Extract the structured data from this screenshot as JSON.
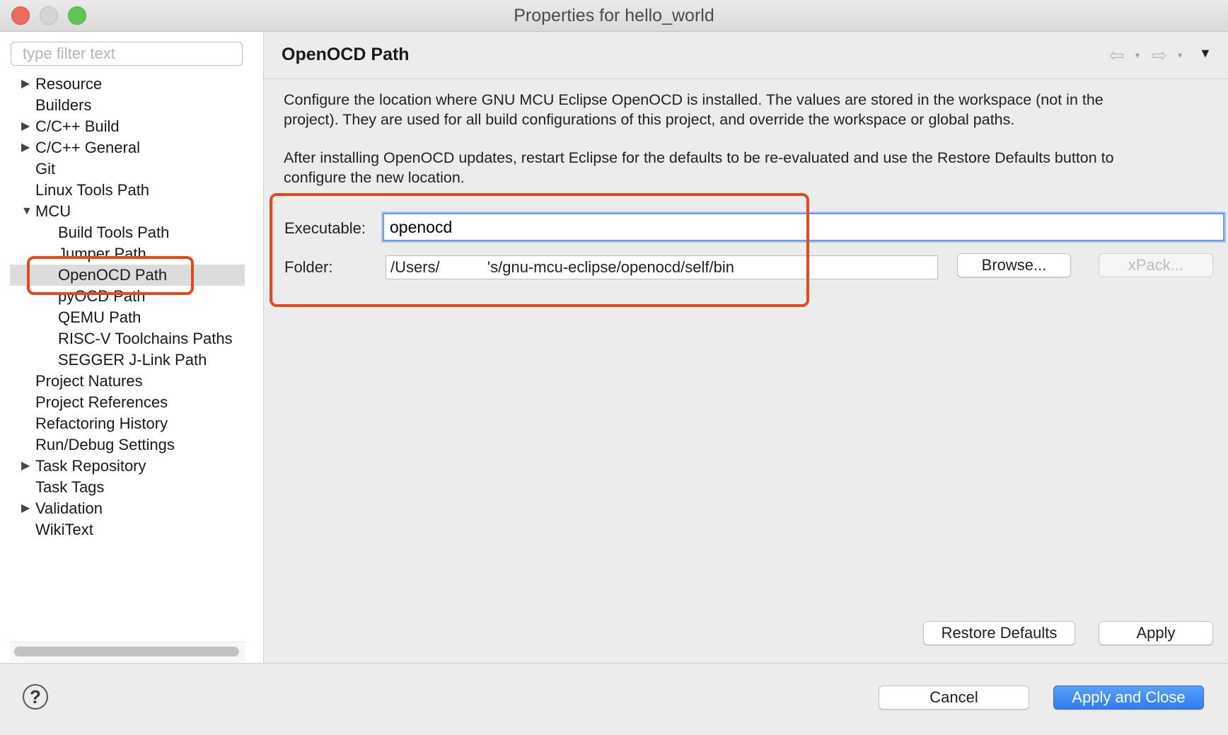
{
  "window": {
    "title": "Properties for hello_world"
  },
  "filter": {
    "placeholder": "type filter text",
    "value": ""
  },
  "tree": [
    {
      "label": "Resource",
      "expander": "▶"
    },
    {
      "label": "Builders",
      "expander": ""
    },
    {
      "label": "C/C++ Build",
      "expander": "▶"
    },
    {
      "label": "C/C++ General",
      "expander": "▶"
    },
    {
      "label": "Git",
      "expander": ""
    },
    {
      "label": "Linux Tools Path",
      "expander": ""
    },
    {
      "label": "MCU",
      "expander": "▼"
    },
    {
      "label": "Build Tools Path",
      "expander": ""
    },
    {
      "label": "Jumper Path",
      "expander": ""
    },
    {
      "label": "OpenOCD Path",
      "expander": "",
      "selected": true
    },
    {
      "label": "pyOCD Path",
      "expander": ""
    },
    {
      "label": "QEMU Path",
      "expander": ""
    },
    {
      "label": "RISC-V Toolchains Paths",
      "expander": ""
    },
    {
      "label": "SEGGER J-Link Path",
      "expander": ""
    },
    {
      "label": "Project Natures",
      "expander": ""
    },
    {
      "label": "Project References",
      "expander": ""
    },
    {
      "label": "Refactoring History",
      "expander": ""
    },
    {
      "label": "Run/Debug Settings",
      "expander": ""
    },
    {
      "label": "Task Repository",
      "expander": "▶"
    },
    {
      "label": "Task Tags",
      "expander": ""
    },
    {
      "label": "Validation",
      "expander": "▶"
    },
    {
      "label": "WikiText",
      "expander": ""
    }
  ],
  "page": {
    "title": "OpenOCD Path",
    "nav": {
      "back_icon": "⇦",
      "forward_icon": "⇨",
      "dropdown": "▾",
      "menu": "▼"
    },
    "desc1_line1": "Configure the location where GNU MCU Eclipse OpenOCD is installed. The values are stored in the workspace (not in the",
    "desc1_line2": "project). They are used for all build configurations of this project, and override the workspace or global paths.",
    "desc2_line1": "After installing OpenOCD updates, restart Eclipse for the defaults to be re-evaluated and use the Restore Defaults button to",
    "desc2_line2": "configure the new location.",
    "executable_label": "Executable:",
    "executable_value": "openocd",
    "folder_label": "Folder:",
    "folder_value": "/Users/           's/gnu-mcu-eclipse/openocd/self/bin",
    "browse_label": "Browse...",
    "xpack_label": "xPack...",
    "restore_label": "Restore Defaults",
    "apply_label": "Apply"
  },
  "footer": {
    "help_icon": "?",
    "cancel_label": "Cancel",
    "apply_close_label": "Apply and Close"
  },
  "colors": {
    "highlight": "#e6471d",
    "primary": "#2f7cf6"
  }
}
